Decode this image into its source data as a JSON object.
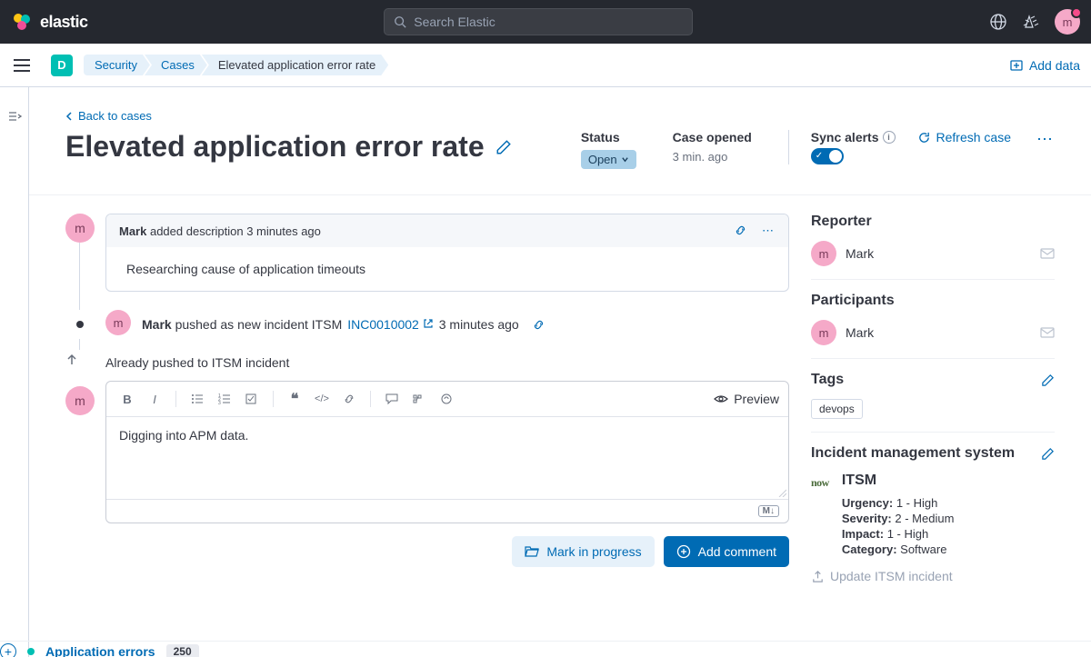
{
  "nav": {
    "brand": "elastic",
    "search_placeholder": "Search Elastic",
    "avatar_initial": "m",
    "space_initial": "D",
    "add_data": "Add data"
  },
  "breadcrumbs": [
    "Security",
    "Cases",
    "Elevated application error rate"
  ],
  "page": {
    "back": "Back to cases",
    "title": "Elevated application error rate",
    "status_label": "Status",
    "status_value": "Open",
    "opened_label": "Case opened",
    "opened_value": "3 min. ago",
    "sync_label": "Sync alerts",
    "refresh": "Refresh case"
  },
  "activity": {
    "desc_author": "Mark",
    "desc_action": " added description ",
    "desc_time": "3 minutes ago",
    "desc_body": "Researching cause of application timeouts",
    "push_author": "Mark",
    "push_action": " pushed as new incident ITSM ",
    "push_ref": "INC0010002",
    "push_time": "3 minutes ago",
    "pushed_note": "Already pushed to ITSM incident",
    "avatar_initial": "m"
  },
  "editor": {
    "content": "Digging into APM data.",
    "preview": "Preview",
    "md_badge": "M↓"
  },
  "actions": {
    "mark_progress": "Mark in progress",
    "add_comment": "Add comment"
  },
  "side": {
    "reporter_title": "Reporter",
    "participants_title": "Participants",
    "tags_title": "Tags",
    "ims_title": "Incident management system",
    "person_name": "Mark",
    "person_initial": "m",
    "tag": "devops",
    "itsm_name": "ITSM",
    "urgency_label": "Urgency:",
    "urgency_value": " 1 - High",
    "severity_label": "Severity:",
    "severity_value": " 2 - Medium",
    "impact_label": "Impact:",
    "impact_value": " 1 - High",
    "category_label": "Category:",
    "category_value": " Software",
    "update_link": "Update ITSM incident",
    "now_logo": "now"
  },
  "bottom": {
    "label": "Application errors",
    "count": "250"
  }
}
